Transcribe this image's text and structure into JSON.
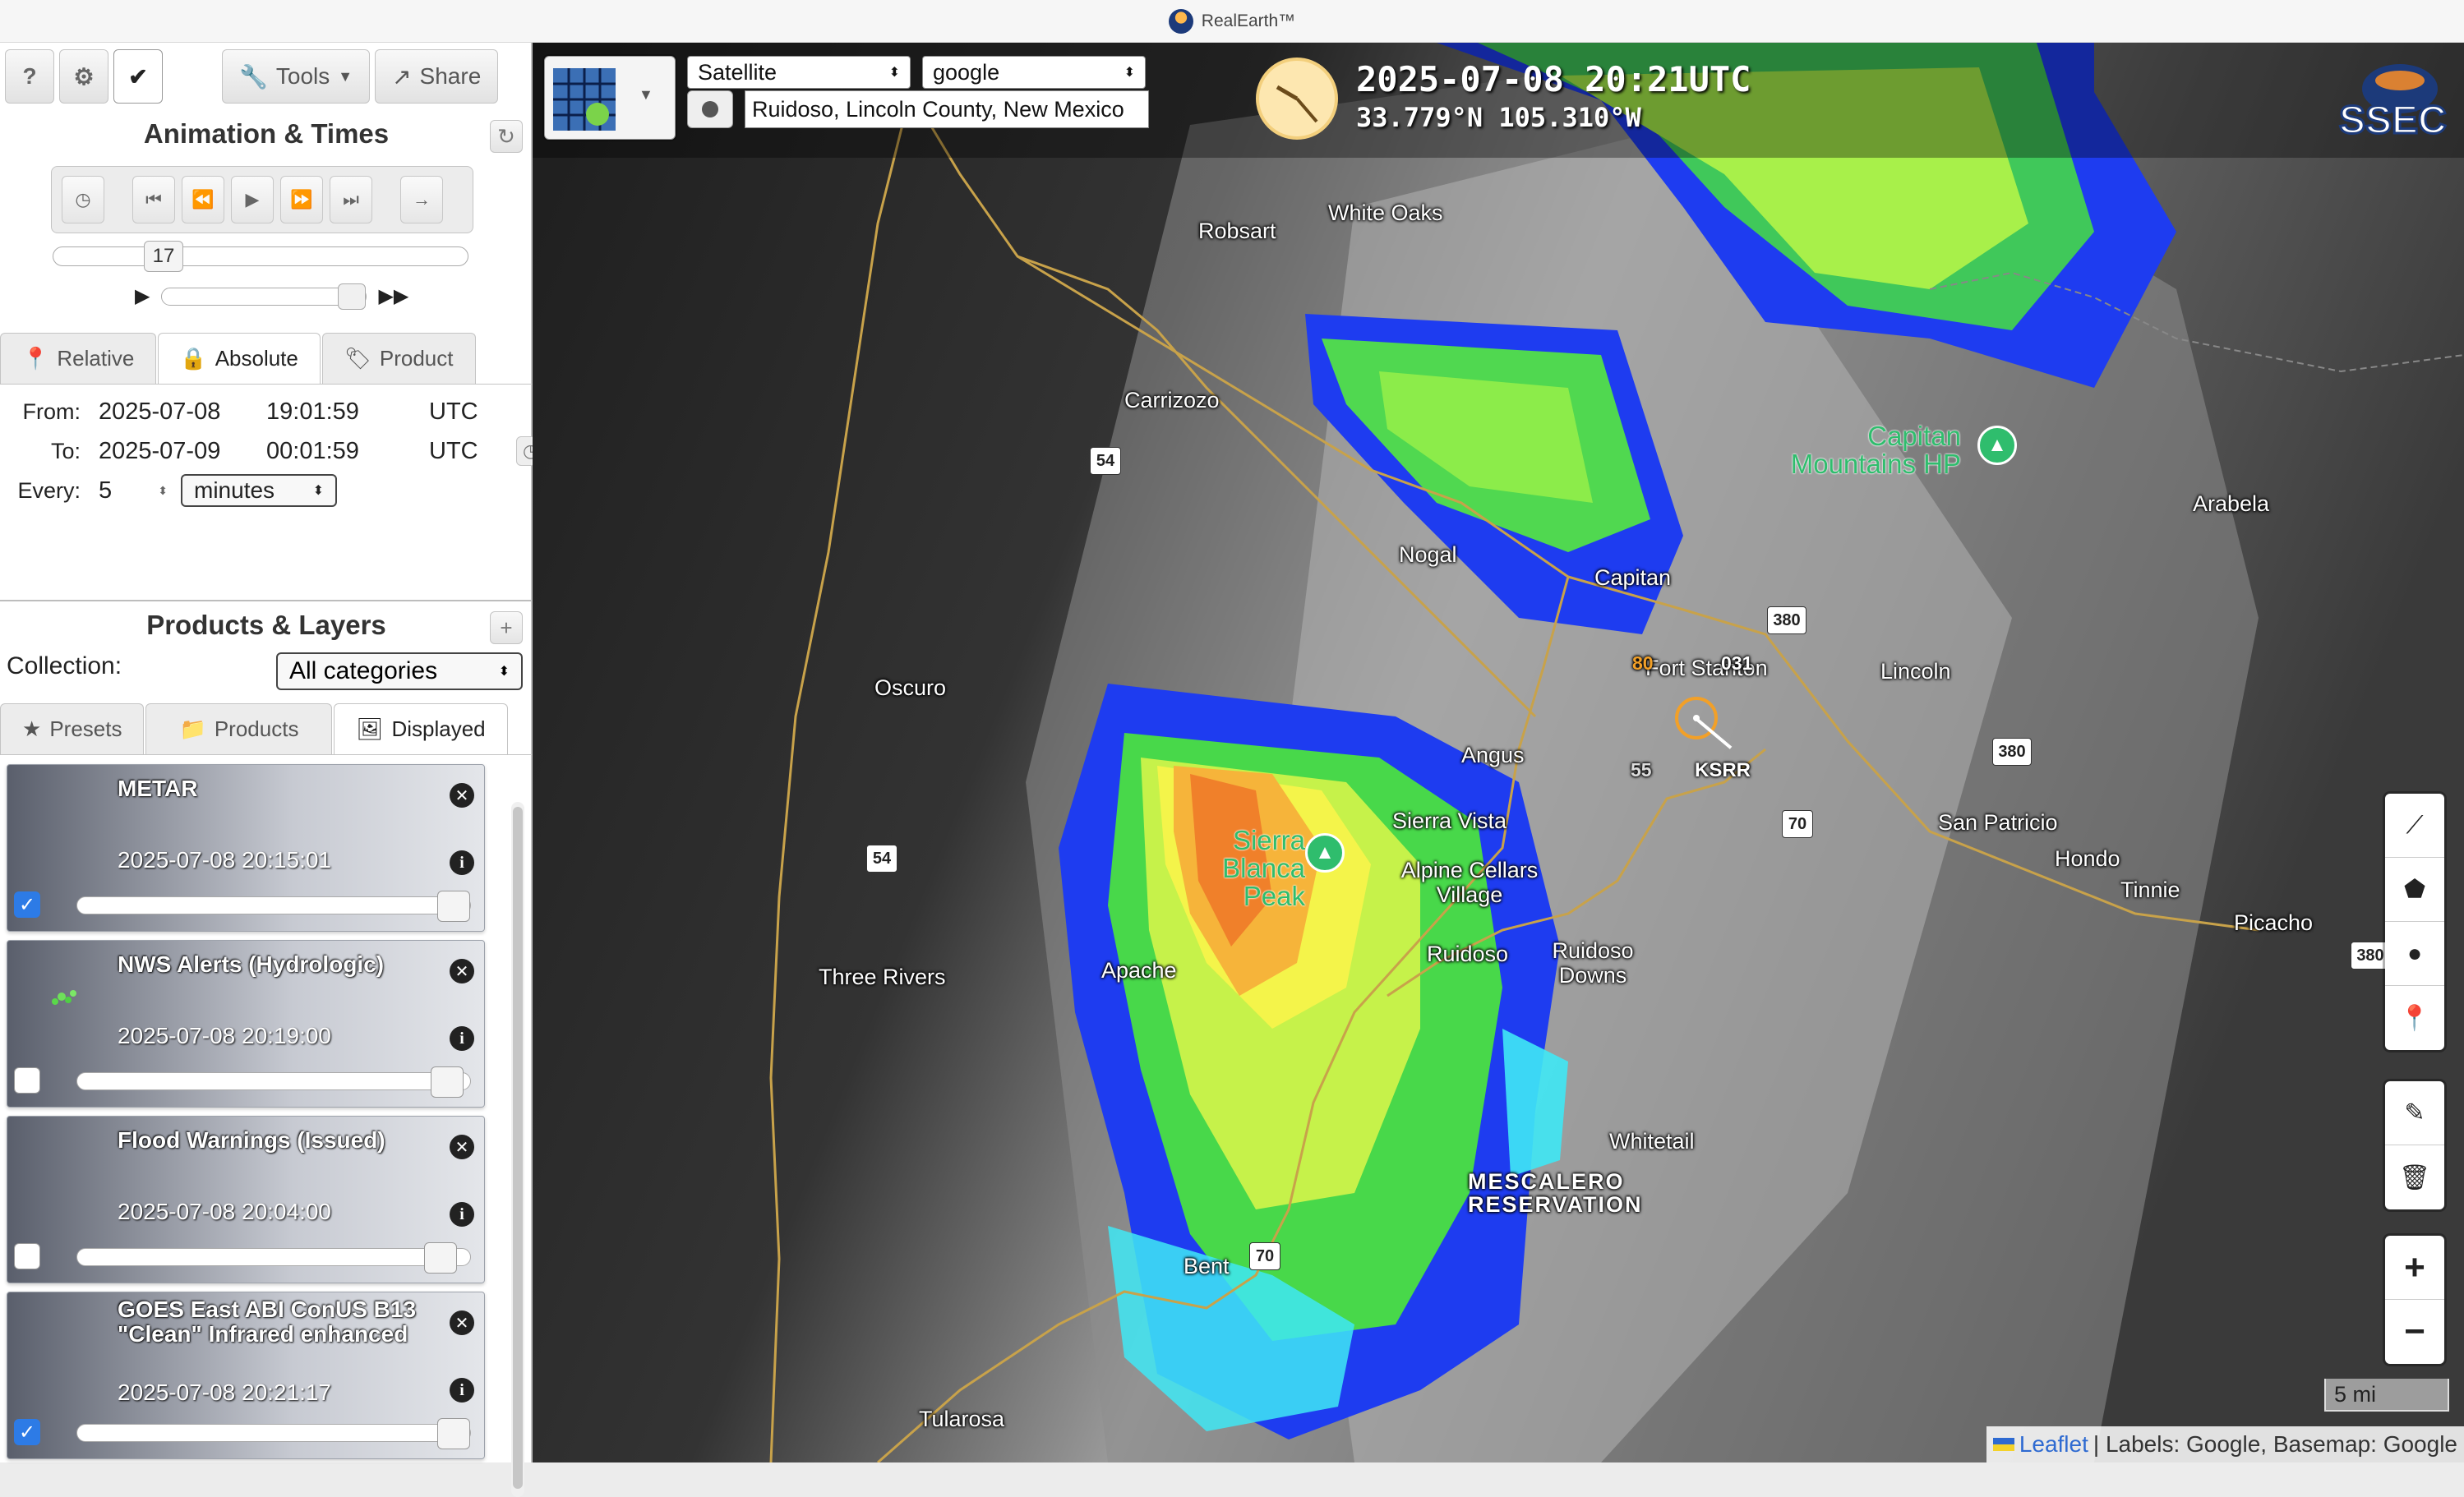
{
  "app": {
    "title": "RealEarth™"
  },
  "sidebar": {
    "top_buttons": {
      "help": "?",
      "settings": "⚙",
      "check": "✔",
      "tools": "Tools",
      "share": "Share"
    },
    "animation": {
      "title": "Animation & Times",
      "frame": "17",
      "tabs": [
        "Relative",
        "Absolute",
        "Product"
      ],
      "selected_tab": "Absolute",
      "from_label": "From:",
      "from_date": "2025-07-08",
      "from_time": "19:01:59",
      "to_label": "To:",
      "to_date": "2025-07-09",
      "to_time": "00:01:59",
      "tz": "UTC",
      "every_label": "Every:",
      "every_value": "5",
      "every_unit": "minutes"
    },
    "products": {
      "title": "Products & Layers",
      "collection_label": "Collection:",
      "collection_value": "All categories",
      "tabs": [
        "Presets",
        "Products",
        "Displayed"
      ],
      "selected_tab": "Displayed",
      "layers": [
        {
          "name": "METAR",
          "time": "2025-07-08 20:15:01",
          "checked": true,
          "opacity": 1.0
        },
        {
          "name": "NWS Alerts (Hydrologic)",
          "time": "2025-07-08 20:19:00",
          "checked": false,
          "opacity": 0.97
        },
        {
          "name": "Flood Warnings (Issued)",
          "time": "2025-07-08 20:04:00",
          "checked": false,
          "opacity": 0.95
        },
        {
          "name": "GOES East ABI ConUS B13 \"Clean\" Infrared enhanced",
          "time": "2025-07-08 20:21:17",
          "checked": true,
          "opacity": 1.0
        }
      ]
    }
  },
  "map": {
    "imagery_select": "Satellite",
    "basemap_select": "google",
    "location": "Ruidoso, Lincoln County, New Mexico",
    "datetime": "2025-07-08 20:21UTC",
    "coords": "33.779°N 105.310°W",
    "logo": "SSEC",
    "places": {
      "white_oaks": "White Oaks",
      "robsart": "Robsart",
      "carrizozo": "Carrizozo",
      "capitan_mountains": "Capitan Mountains HP",
      "arabela": "Arabela",
      "nogal": "Nogal",
      "capitan": "Capitan",
      "oscuro": "Oscuro",
      "fort_stanton": "Fort Stanton",
      "lincoln": "Lincoln",
      "angus": "Angus",
      "ksrr": "KSRR",
      "station_value": "80",
      "station_value2": "031",
      "station_55": "55",
      "sierra_blanca": "Sierra Blanca Peak",
      "sierra_vista": "Sierra Vista",
      "alpine_cellars": "Alpine Cellars Village",
      "san_patricio": "San Patricio",
      "hondo": "Hondo",
      "tinnie": "Tinnie",
      "picacho": "Picacho",
      "three_rivers": "Three Rivers",
      "apache": "Apache",
      "ruidoso": "Ruidoso",
      "ruidoso_downs": "Ruidoso Downs",
      "whitetail": "Whitetail",
      "mescalero": "MESCALERO RESERVATION",
      "bent": "Bent",
      "tularosa": "Tularosa"
    },
    "shields": {
      "us54a": "54",
      "us54b": "54",
      "us380a": "380",
      "us380b": "380",
      "us380c": "380",
      "us70a": "70",
      "us70b": "70"
    },
    "scale": "5 mi",
    "attribution": {
      "leaflet": "Leaflet",
      "rest": "| Labels: Google, Basemap: Google"
    }
  },
  "colors": {
    "accent": "#2d7be6",
    "ir_warm": "#f08a2a",
    "ir_yellow": "#f4f44a",
    "ir_green": "#5ee34a",
    "ir_blue": "#1a3ef0",
    "ir_cyan": "#3fe8f5"
  }
}
